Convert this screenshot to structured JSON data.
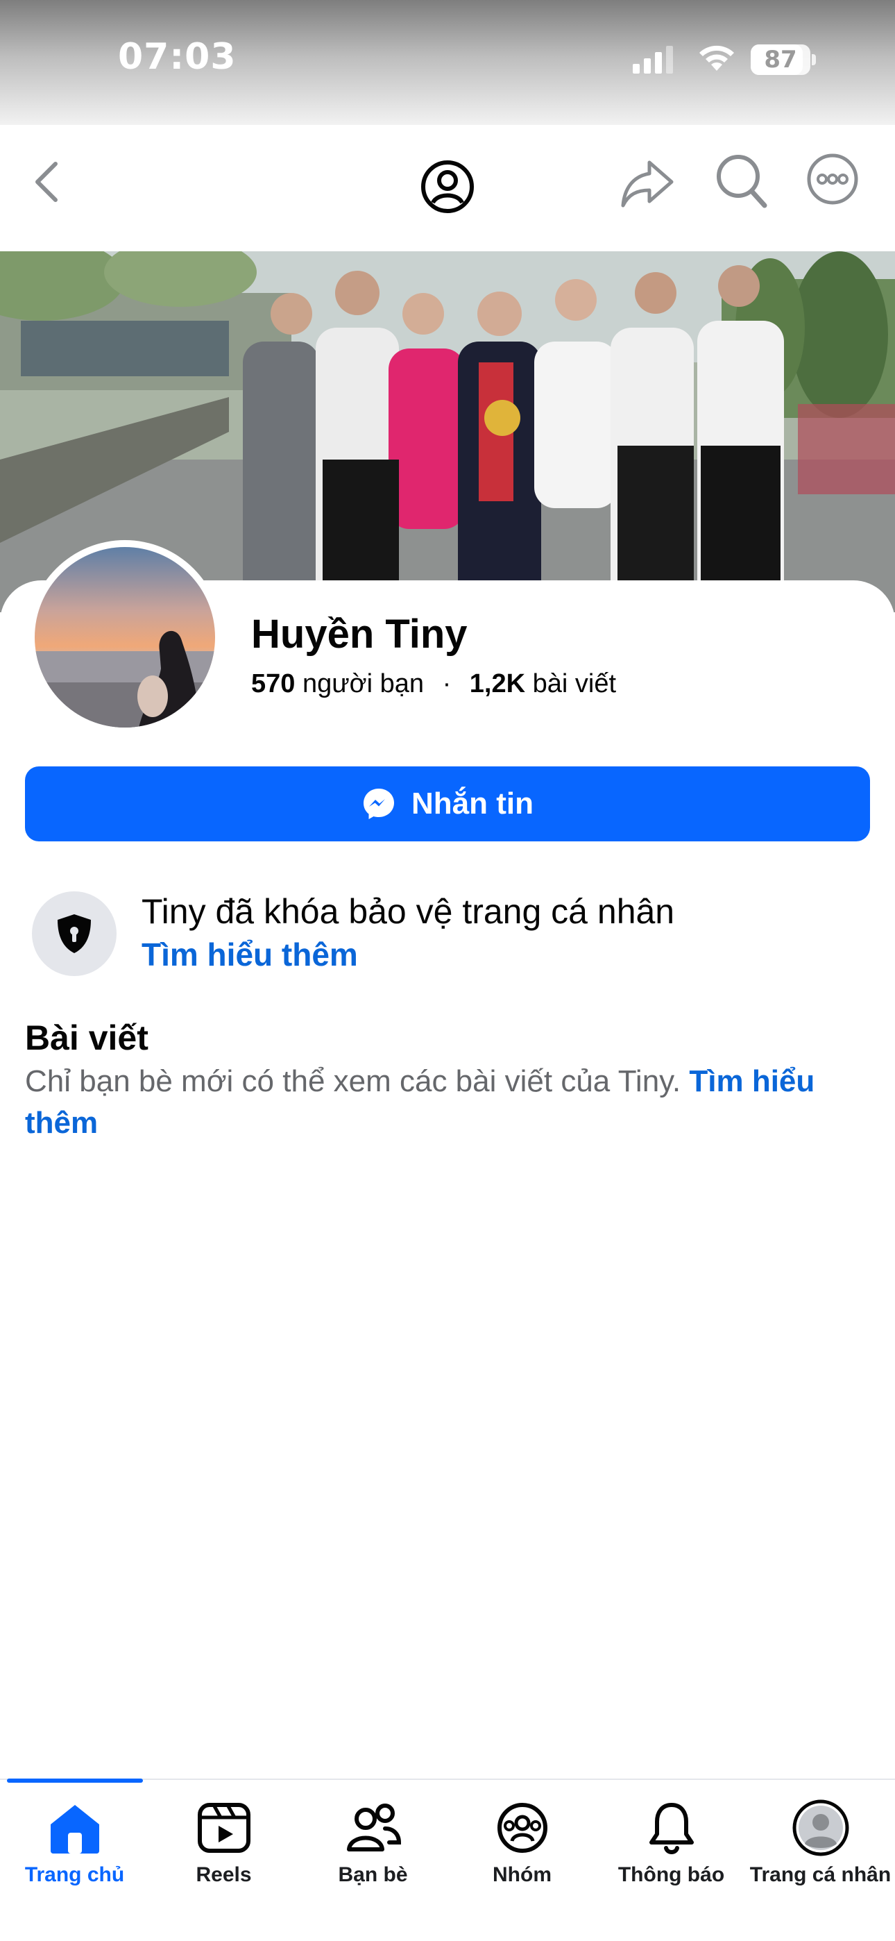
{
  "status_bar": {
    "time": "07:03",
    "battery": "87",
    "battery_level": 0.87
  },
  "header": {
    "icons": [
      "chevron-left-icon",
      "profile-icon",
      "share-icon",
      "search-icon",
      "more-icon"
    ]
  },
  "profile": {
    "name": "Huyền Tiny",
    "friends_count": "570",
    "friends_label": "người bạn",
    "separator": "·",
    "posts_count": "1,2K",
    "posts_label": "bài viết"
  },
  "message_button": {
    "label": "Nhắn tin",
    "icon": "messenger-icon"
  },
  "lock_notice": {
    "title": "Tiny đã khóa bảo vệ trang cá nhân",
    "link": "Tìm hiểu thêm",
    "icon": "shield-lock-icon"
  },
  "posts_section": {
    "title": "Bài viết",
    "text": "Chỉ bạn bè mới có thể xem các bài viết của Tiny. ",
    "link": "Tìm hiểu thêm"
  },
  "tabbar": {
    "active": 0,
    "tabs": [
      {
        "label": "Trang chủ",
        "icon": "home-icon"
      },
      {
        "label": "Reels",
        "icon": "reels-icon"
      },
      {
        "label": "Bạn bè",
        "icon": "friends-icon"
      },
      {
        "label": "Nhóm",
        "icon": "groups-icon"
      },
      {
        "label": "Thông báo",
        "icon": "bell-icon"
      },
      {
        "label": "Trang cá nhân",
        "icon": "avatar-icon"
      }
    ]
  },
  "colors": {
    "accent": "#0866ff",
    "link": "#0a66d8",
    "secondary_text": "#65676b"
  }
}
